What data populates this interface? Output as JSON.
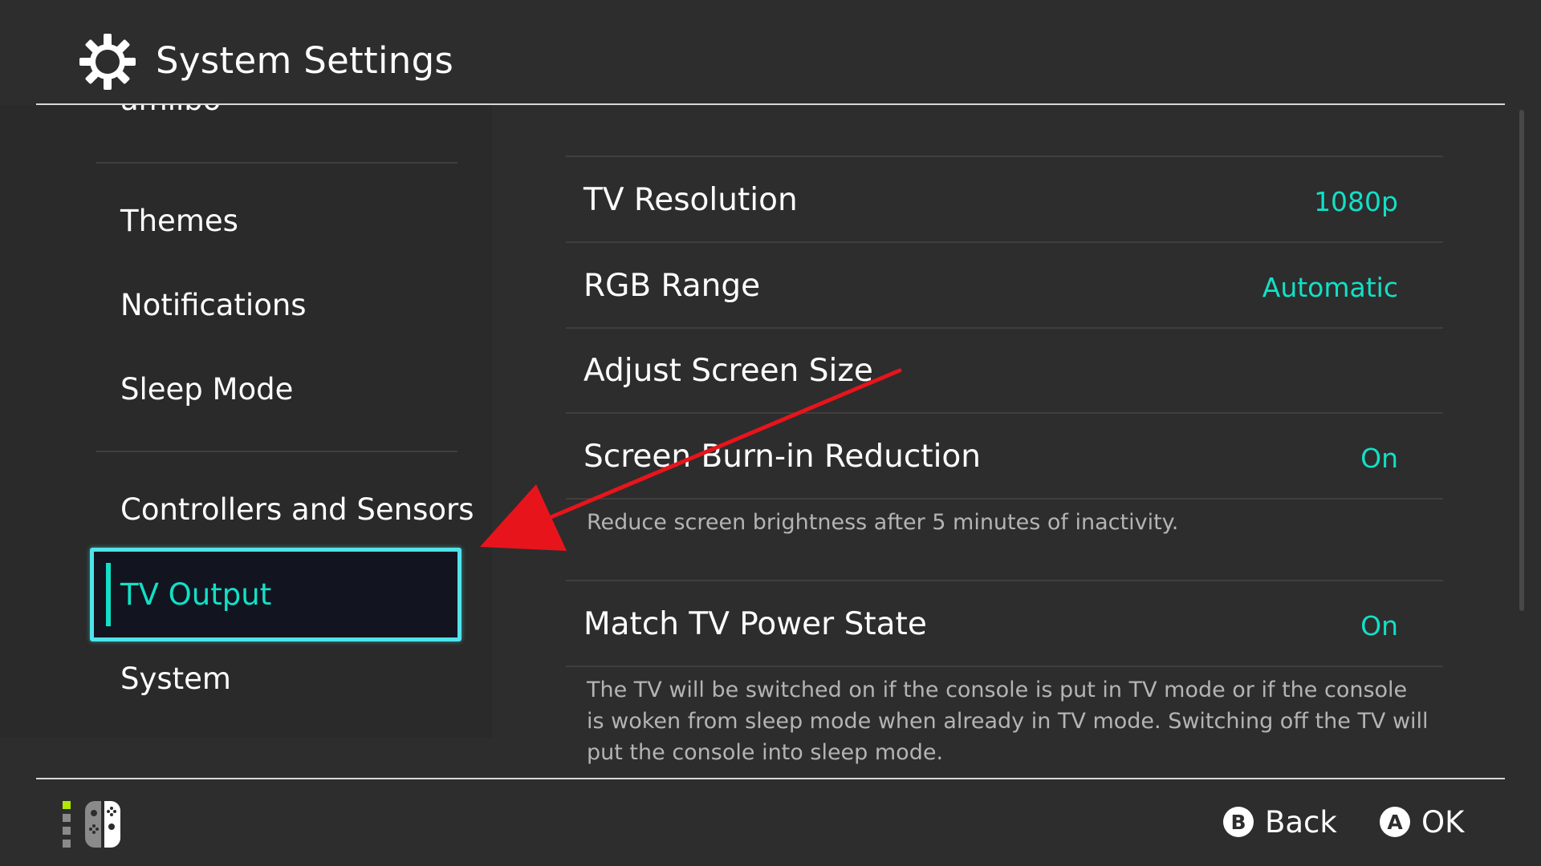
{
  "header": {
    "title": "System Settings",
    "icon": "gear-icon"
  },
  "sidebar": {
    "items": [
      {
        "label": "amiibo"
      },
      {
        "label": "Themes"
      },
      {
        "label": "Notifications"
      },
      {
        "label": "Sleep Mode"
      },
      {
        "label": "Controllers and Sensors"
      },
      {
        "label": "TV Output",
        "selected": true
      },
      {
        "label": "System"
      }
    ]
  },
  "main": {
    "rows": [
      {
        "label": "TV Resolution",
        "value": "1080p"
      },
      {
        "label": "RGB Range",
        "value": "Automatic"
      },
      {
        "label": "Adjust Screen Size",
        "value": ""
      },
      {
        "label": "Screen Burn-in Reduction",
        "value": "On",
        "description": "Reduce screen brightness after 5 minutes of inactivity."
      },
      {
        "label": "Match TV Power State",
        "value": "On",
        "description": "The TV will be switched on if the console is put in TV mode or if the console is woken from sleep mode when already in TV mode. Switching off the TV will put the console into sleep mode."
      }
    ]
  },
  "footer": {
    "controller_icon": "joy-con-icon",
    "buttons": [
      {
        "glyph": "B",
        "label": "Back"
      },
      {
        "glyph": "A",
        "label": "OK"
      }
    ]
  },
  "colors": {
    "background": "#2d2d2d",
    "sidebar": "#2a2a2a",
    "accent": "#12e0c6",
    "selection_border": "#4fe3ea",
    "selection_fill": "#121520",
    "annotation_arrow": "#e8141c",
    "description_text": "#b4b4b4"
  }
}
